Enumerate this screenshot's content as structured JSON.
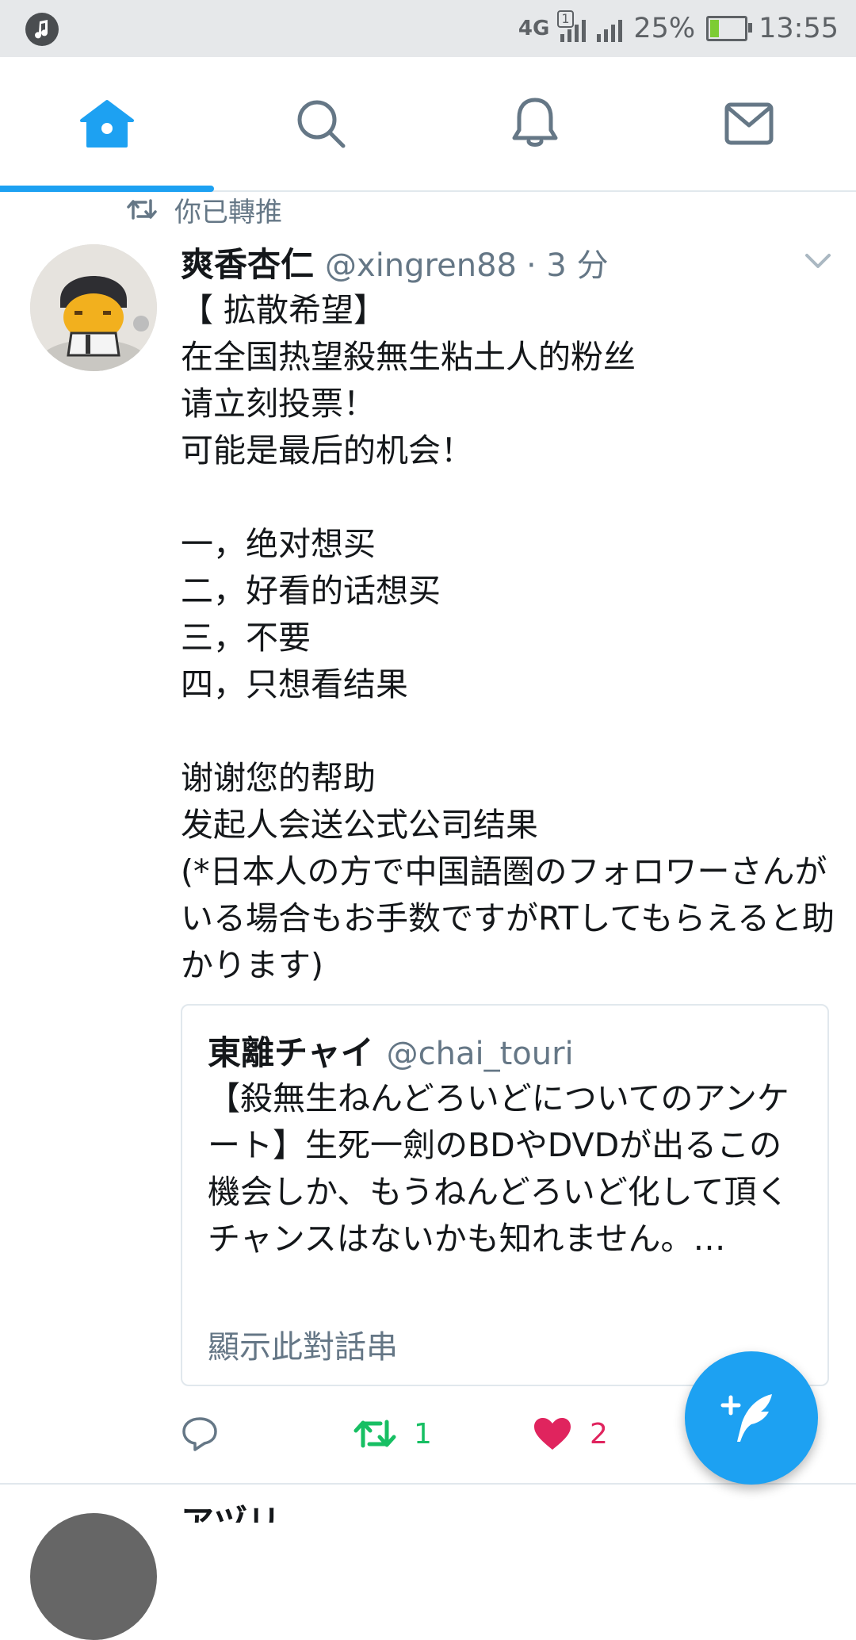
{
  "status_bar": {
    "network": "4G",
    "battery_percent": "25%",
    "battery_level": 0.25,
    "time": "13:55"
  },
  "tabs": [
    {
      "name": "home",
      "icon": "home-icon",
      "active": true
    },
    {
      "name": "search",
      "icon": "search-icon",
      "active": false
    },
    {
      "name": "notifications",
      "icon": "bell-icon",
      "active": false
    },
    {
      "name": "messages",
      "icon": "mail-icon",
      "active": false
    }
  ],
  "retweet_header": {
    "label": "你已轉推",
    "icon": "retweet-icon"
  },
  "tweet": {
    "name": "爽香杏仁",
    "handle": "@xingren88",
    "time": "· 3 分",
    "lines": [
      "【 拡散希望】",
      "在全国热望殺無生粘土人的粉丝",
      "请立刻投票！",
      "可能是最后的机会！",
      "",
      "一，绝对想买",
      "二，好看的话想买",
      "三，不要",
      "四，只想看结果",
      "",
      "谢谢您的帮助",
      "发起人会送公式公司结果"
    ],
    "wrapped_text": "(*日本人の方で中国語圏のフォロワーさんがいる場合もお手数ですがRTしてもらえると助かります)",
    "quoted": {
      "name": "東離チャイ",
      "handle": "@chai_touri",
      "text": "【殺無生ねんどろいどについてのアンケート】生死一劍のBDやDVDが出るこの機会しか、もうねんどろいど化して頂くチャンスはないかも知れません。…",
      "show_thread": "顯示此對話串"
    },
    "actions": {
      "reply_count": "",
      "retweet_count": "1",
      "like_count": "2"
    }
  },
  "next_tweet": {
    "name": "アヅリ"
  },
  "colors": {
    "accent": "#1da1f2",
    "retweet": "#17bf63",
    "like": "#e0245e",
    "secondary_text": "#657786"
  }
}
